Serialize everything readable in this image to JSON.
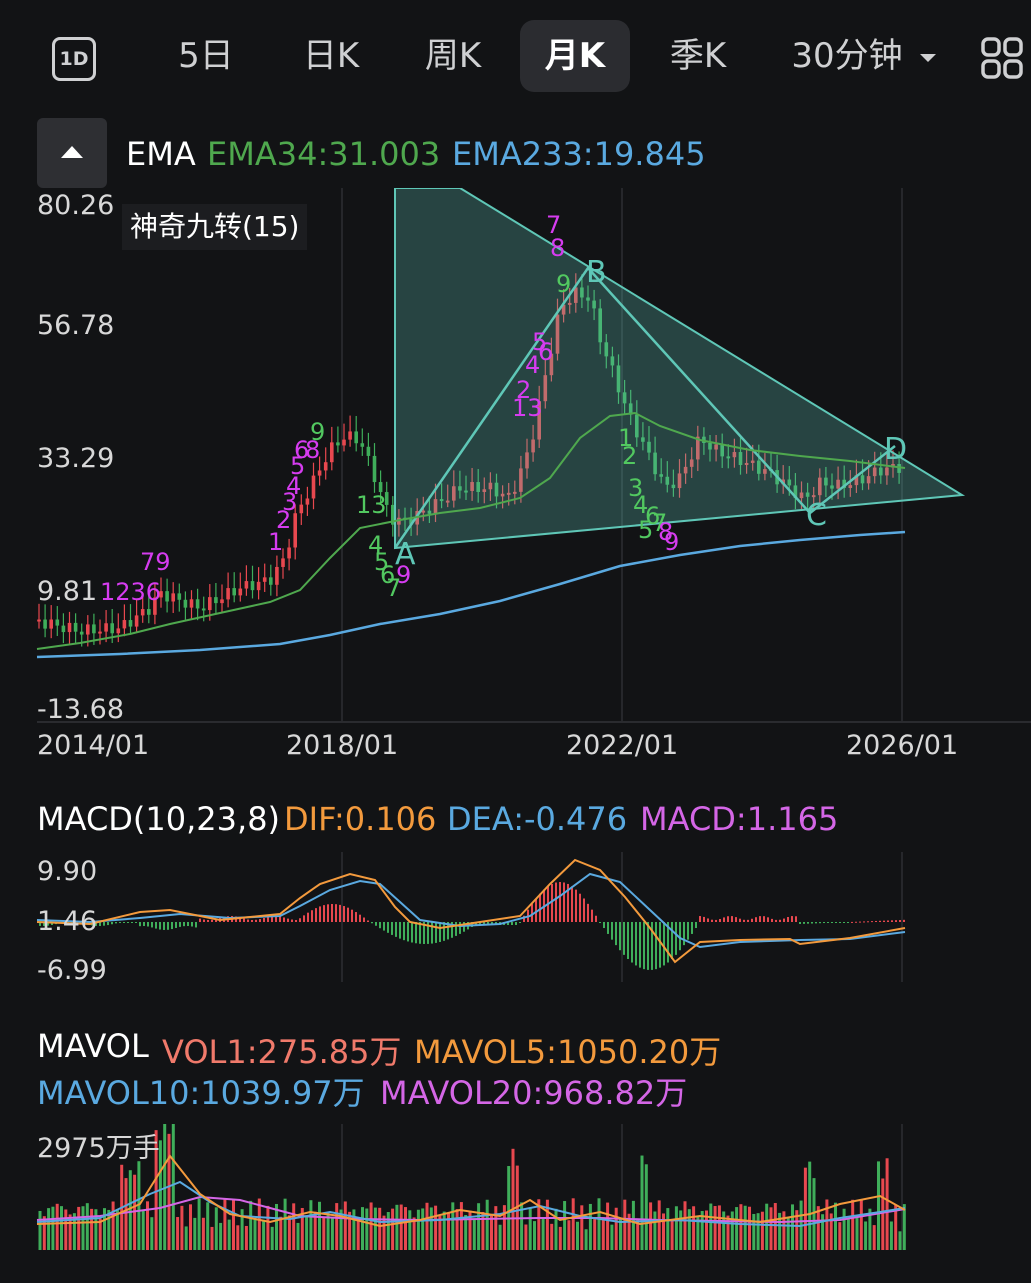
{
  "toolbar": {
    "tabs": [
      {
        "label": "1D",
        "icon": "1d-icon"
      },
      {
        "label": "5日"
      },
      {
        "label": "日K"
      },
      {
        "label": "周K"
      },
      {
        "label": "月K",
        "active": true
      },
      {
        "label": "季K"
      },
      {
        "label": "30分钟",
        "dropdown": true
      }
    ],
    "layout_icon": "grid-icon"
  },
  "indicator": {
    "name": "EMA",
    "ema34": "EMA34:31.003",
    "ema233": "EMA233:19.845",
    "nine_turn": "神奇九转(15)"
  },
  "main_chart": {
    "y_ticks": [
      "80.26",
      "56.78",
      "33.29",
      "9.81",
      "-13.68"
    ],
    "x_ticks": [
      "2014/01",
      "2018/01",
      "2022/01",
      "2026/01"
    ],
    "pattern_points": [
      "A",
      "B",
      "C",
      "D"
    ]
  },
  "macd": {
    "title": "MACD(10,23,8)",
    "dif": "DIF:0.106",
    "dea": "DEA:-0.476",
    "macd": "MACD:1.165",
    "y_ticks": [
      "9.90",
      "1.46",
      "-6.99"
    ]
  },
  "mavol": {
    "title": "MAVOL",
    "vol1": "VOL1:275.85万",
    "mavol5": "MAVOL5:1050.20万",
    "mavol10": "MAVOL10:1039.97万",
    "mavol20": "MAVOL20:968.82万",
    "y_max": "2975万手"
  },
  "colors": {
    "up": "#e8484f",
    "down": "#3fae5a",
    "ema34": "#4fa84e",
    "ema233": "#5aa9e0",
    "dif": "#f39a3d",
    "dea": "#5aa9e0",
    "macd": "#d466e6",
    "pattern": "#5fc7b7",
    "nine_up": "#d63cf0",
    "nine_down": "#52c860"
  }
}
